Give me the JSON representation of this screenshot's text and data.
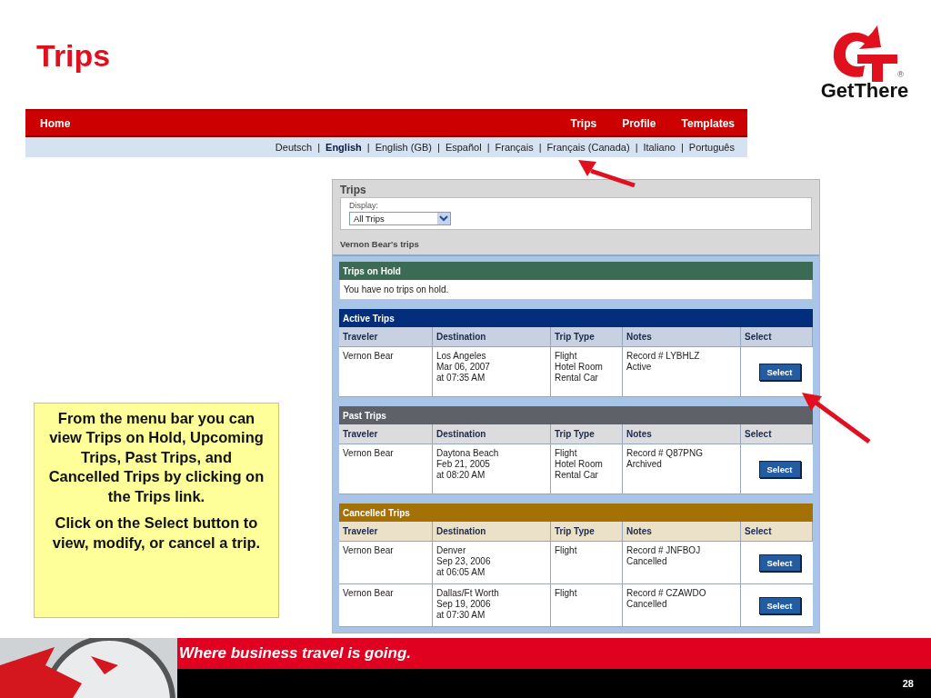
{
  "slide_title": "Trips",
  "logo": {
    "wordmark": "GetThere",
    "mark": "®"
  },
  "nav": {
    "left_items": [
      {
        "label": "Home"
      }
    ],
    "right_items": [
      {
        "label": "Trips"
      },
      {
        "label": "Profile"
      },
      {
        "label": "Templates"
      }
    ],
    "separator": "|",
    "languages": [
      {
        "label": "Deutsch",
        "selected": false
      },
      {
        "label": "English",
        "selected": true
      },
      {
        "label": "English (GB)",
        "selected": false
      },
      {
        "label": "Español",
        "selected": false
      },
      {
        "label": "Français",
        "selected": false
      },
      {
        "label": "Français (Canada)",
        "selected": false
      },
      {
        "label": "Italiano",
        "selected": false
      },
      {
        "label": "Português",
        "selected": false
      }
    ]
  },
  "panel": {
    "title": "Trips",
    "display_label": "Display:",
    "display_value": "All Trips",
    "owner": "Vernon Bear's trips",
    "sections": [
      {
        "title": "Trips on Hold",
        "kind": "message",
        "color": "#3b6b55",
        "message": "You have no trips on hold."
      },
      {
        "title": "Active Trips",
        "kind": "table",
        "color": "#022e7c",
        "columns": [
          "Traveler",
          "Destination",
          "Trip Type",
          "Notes",
          "Select"
        ],
        "rows": [
          {
            "traveler": "Vernon Bear",
            "destination": [
              "Los Angeles",
              "Mar 06, 2007",
              "at 07:35 AM"
            ],
            "trip_type": [
              "Flight",
              "Hotel Room",
              "Rental Car"
            ],
            "notes": [
              "Record # LYBHLZ",
              "Active"
            ],
            "button": "Select"
          }
        ]
      },
      {
        "title": "Past Trips",
        "kind": "table",
        "color": "#5e6168",
        "columns": [
          "Traveler",
          "Destination",
          "Trip Type",
          "Notes",
          "Select"
        ],
        "rows": [
          {
            "traveler": "Vernon Bear",
            "destination": [
              "Daytona Beach",
              "Feb 21, 2005",
              "at 08:20 AM"
            ],
            "trip_type": [
              "Flight",
              "Hotel Room",
              "Rental Car"
            ],
            "notes": [
              "Record # Q87PNG",
              "Archived"
            ],
            "button": "Select"
          }
        ]
      },
      {
        "title": "Cancelled Trips",
        "kind": "table",
        "color": "#a47106",
        "columns": [
          "Traveler",
          "Destination",
          "Trip Type",
          "Notes",
          "Select"
        ],
        "rows": [
          {
            "traveler": "Vernon Bear",
            "destination": [
              "Denver",
              "Sep 23, 2006",
              "at 06:05 AM"
            ],
            "trip_type": [
              "Flight"
            ],
            "notes": [
              "Record # JNFBOJ",
              "Cancelled"
            ],
            "button": "Select"
          },
          {
            "traveler": "Vernon Bear",
            "destination": [
              "Dallas/Ft Worth",
              "Sep 19, 2006",
              "at 07:30 AM"
            ],
            "trip_type": [
              "Flight"
            ],
            "notes": [
              "Record # CZAWDO",
              "Cancelled"
            ],
            "button": "Select"
          }
        ]
      }
    ]
  },
  "callout": [
    "From the menu bar you can view Trips on Hold, Upcoming Trips, Past Trips, and Cancelled Trips by clicking on the Trips link.",
    "Click on the Select button to view, modify, or cancel a trip."
  ],
  "footer": {
    "slogan": "Where business travel is going.",
    "page_number": "28"
  }
}
